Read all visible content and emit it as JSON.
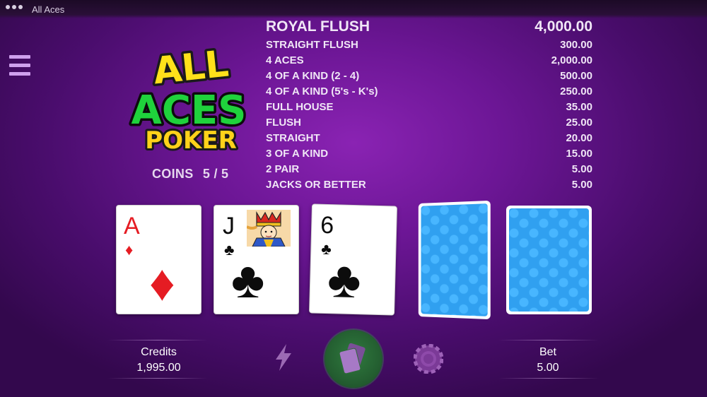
{
  "window": {
    "title": "All Aces"
  },
  "logo": {
    "line1": "ALL",
    "line2": "ACES",
    "line3": "POKER"
  },
  "coins": {
    "label": "COINS",
    "value": "5 / 5"
  },
  "paytable": [
    {
      "hand": "ROYAL FLUSH",
      "payout": "4,000.00"
    },
    {
      "hand": "STRAIGHT FLUSH",
      "payout": "300.00"
    },
    {
      "hand": "4 ACES",
      "payout": "2,000.00"
    },
    {
      "hand": "4 OF A KIND (2 - 4)",
      "payout": "500.00"
    },
    {
      "hand": "4 OF A KIND (5's - K's)",
      "payout": "250.00"
    },
    {
      "hand": "FULL HOUSE",
      "payout": "35.00"
    },
    {
      "hand": "FLUSH",
      "payout": "25.00"
    },
    {
      "hand": "STRAIGHT",
      "payout": "20.00"
    },
    {
      "hand": "3 OF A KIND",
      "payout": "15.00"
    },
    {
      "hand": "2 PAIR",
      "payout": "5.00"
    },
    {
      "hand": "JACKS OR BETTER",
      "payout": "5.00"
    }
  ],
  "cards": [
    {
      "rank": "A",
      "suit": "diamonds",
      "suit_glyph": "♦",
      "color": "red",
      "face_up": true
    },
    {
      "rank": "J",
      "suit": "clubs",
      "suit_glyph": "♣",
      "color": "black",
      "face_up": true
    },
    {
      "rank": "6",
      "suit": "clubs",
      "suit_glyph": "♣",
      "color": "black",
      "face_up": true
    },
    {
      "face_up": false
    },
    {
      "face_up": false
    }
  ],
  "credits": {
    "label": "Credits",
    "value": "1,995.00"
  },
  "bet": {
    "label": "Bet",
    "value": "5.00"
  },
  "controls": {
    "turbo_icon": "lightning-bolt-icon",
    "deal_icon": "cards-icon",
    "chip_icon": "poker-chip-icon"
  },
  "colors": {
    "background": "#6c1695",
    "card_back": "#30a0f0",
    "deal_button": "#245f31",
    "logo_yellow": "#ffe11a",
    "logo_green": "#1fd23c"
  }
}
